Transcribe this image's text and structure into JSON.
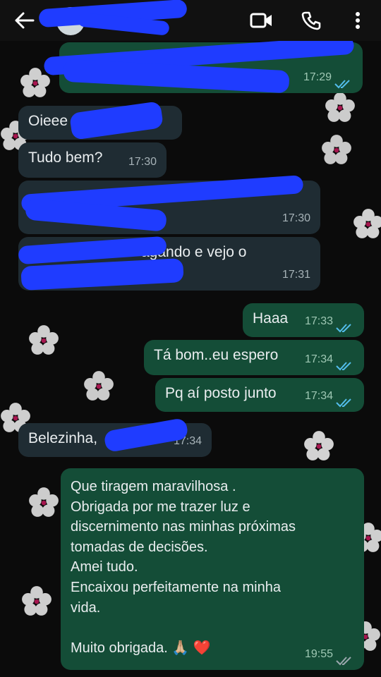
{
  "header": {
    "icons": [
      "back-arrow-icon",
      "video-call-icon",
      "phone-icon",
      "more-vertical-icon"
    ]
  },
  "messages": [
    {
      "id": "m1",
      "dir": "out",
      "text": "",
      "time": "17:29",
      "read": true
    },
    {
      "id": "m2",
      "dir": "in",
      "text": "Oieee",
      "time": "",
      "read": false
    },
    {
      "id": "m3",
      "dir": "in",
      "text": "Tudo bem?",
      "time": "17:30",
      "read": false
    },
    {
      "id": "m4",
      "dir": "in",
      "text": "",
      "time": "17:30",
      "read": false
    },
    {
      "id": "m5",
      "dir": "in",
      "text": "agando e vejo o\n                              dele",
      "time": "17:31",
      "read": false
    },
    {
      "id": "m6",
      "dir": "out",
      "text": "Haaa",
      "time": "17:33",
      "read": true
    },
    {
      "id": "m7",
      "dir": "out",
      "text": "Tá bom..eu espero",
      "time": "17:34",
      "read": true
    },
    {
      "id": "m8",
      "dir": "out",
      "text": "Pq aí posto junto",
      "time": "17:34",
      "read": true
    },
    {
      "id": "m9",
      "dir": "in",
      "text": "Belezinha,",
      "time": "17:34",
      "read": false
    },
    {
      "id": "m10",
      "dir": "out",
      "text": "Que tiragem maravilhosa .\nObrigada por me trazer luz e\ndiscernimento nas minhas próximas\ntomadas de decisões.\nAmei tudo.\nEncaixou perfeitamente na minha\nvida.\n\nMuito obrigada. 🙏🏼 ❤️",
      "time": "19:55",
      "read": true
    }
  ],
  "colors": {
    "incoming_bubble": "#1f2c33",
    "outgoing_bubble": "#144d37",
    "read_ticks": "#53bdeb",
    "redaction": "#1f3cff"
  }
}
